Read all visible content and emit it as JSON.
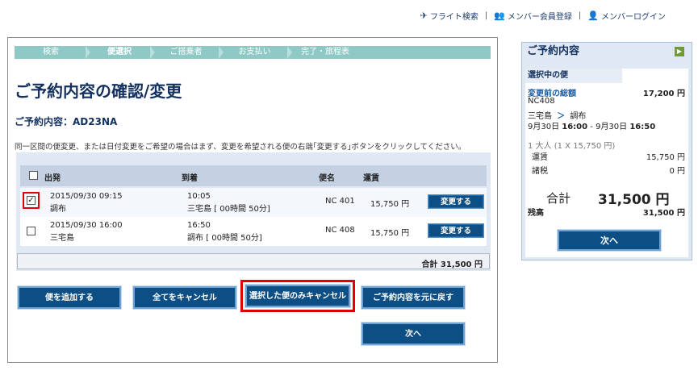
{
  "top_links": [
    {
      "icon": "airplane-icon",
      "glyph": "✈",
      "label": "フライト検索"
    },
    {
      "icon": "member-register-icon",
      "glyph": "👥",
      "label": "メンバー会員登録"
    },
    {
      "icon": "user-icon",
      "glyph": "👤",
      "label": "メンバーログイン"
    }
  ],
  "steps": [
    "検索",
    "便選択",
    "ご搭乗者",
    "お支払い",
    "完了・旅程表"
  ],
  "active_step": 1,
  "title": "ご予約内容の確認/変更",
  "reservation": "ご予約内容：AD23NA",
  "note": "同一区間の便変更、または日付変更をご希望の場合はまず、変更を希望される便の右端｢変更する｣ボタンをクリックしてください。",
  "table": {
    "headers": {
      "departure": "出発",
      "arrival": "到着",
      "flight": "便名",
      "fare": "運賃"
    },
    "rows": [
      {
        "checked": "✓",
        "dep_time": "2015/09/30 09:15",
        "dep_place": "調布",
        "arr_time": "10:05",
        "arr_place": "三宅島 [ 00時間 50分]",
        "flight": "NC 401",
        "fare": "15,750 円",
        "button": "変更する"
      },
      {
        "checked": "",
        "dep_time": "2015/09/30 16:00",
        "dep_place": "三宅島",
        "arr_time": "16:50",
        "arr_place": "調布 [ 00時間 50分]",
        "flight": "NC 408",
        "fare": "15,750 円",
        "button": "変更する"
      }
    ],
    "total": "合計 31,500 円"
  },
  "buttons": {
    "add_flight": "便を追加する",
    "cancel_all": "全てをキャンセル",
    "cancel_selected": "選択した便のみキャンセル",
    "restore": "ご予約内容を元に戻す",
    "next": "次へ"
  },
  "side": {
    "header": "ご予約内容",
    "selected_title": "選択中の便",
    "before_total_label": "変更前の総額",
    "before_total_value": "17,200 円",
    "flight_no": "NC408",
    "route_from": "三宅島",
    "route_arrow": "＞",
    "route_to": "調布",
    "time_line_a": "9月30日 ",
    "time_line_b": "16:00",
    "time_line_c": " - 9月30日 ",
    "time_line_d": "16:50",
    "pax": "1 大人 (1 X 15,750 円)",
    "fare_label": "運賃",
    "fare_value": "15,750 円",
    "tax_label": "諸税",
    "tax_value": "0 円",
    "total_label": "合計",
    "total_value": "31,500 円",
    "balance_label": "残高",
    "balance_value": "31,500 円",
    "next": "次へ"
  },
  "colors": {
    "navy": "#0d4f85",
    "step_bar": "#8fc9c5",
    "highlight": "#e00000"
  }
}
